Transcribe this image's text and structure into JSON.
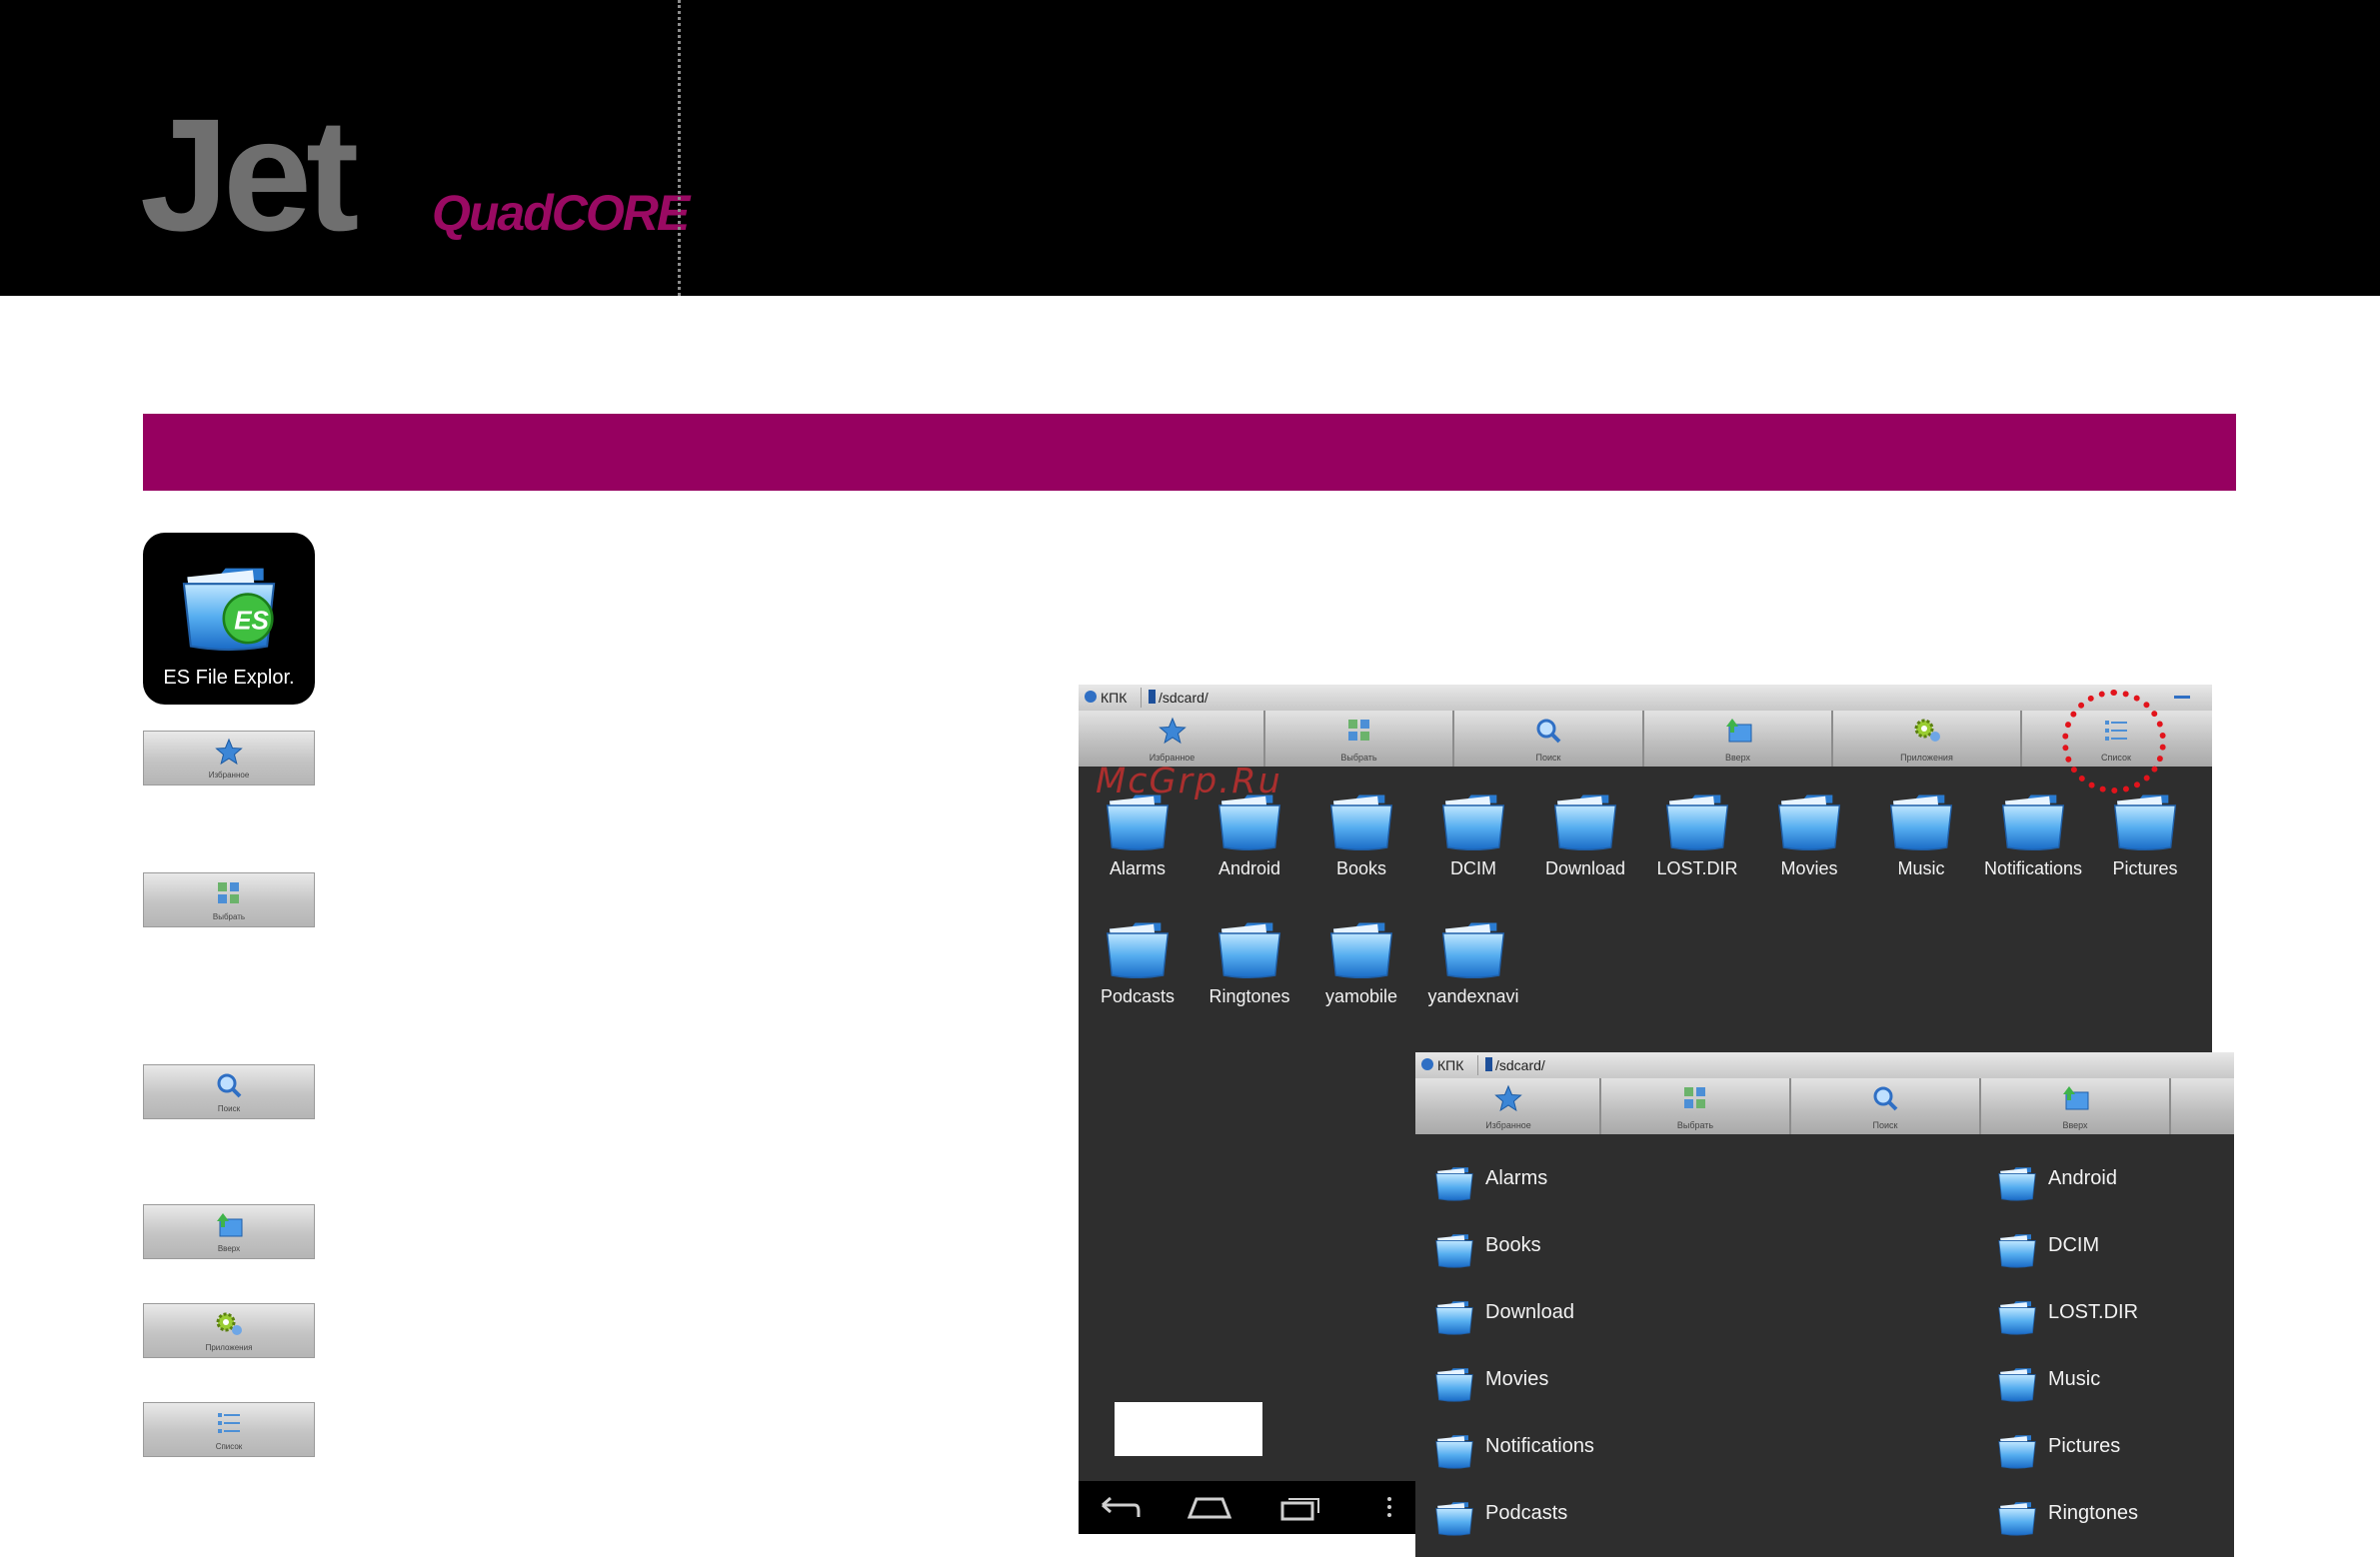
{
  "brand": {
    "name": "Jet",
    "subtitle": "QuadCORE"
  },
  "app_icon": {
    "label": "ES File Explor.",
    "icon": "es-file-explorer-icon"
  },
  "toolbar_buttons": [
    {
      "id": "favorites",
      "label": "Избранное",
      "icon": "star-icon"
    },
    {
      "id": "select",
      "label": "Выбрать",
      "icon": "select-grid-icon"
    },
    {
      "id": "search",
      "label": "Поиск",
      "icon": "magnifier-icon"
    },
    {
      "id": "up",
      "label": "Вверх",
      "icon": "folder-up-icon"
    },
    {
      "id": "apps",
      "label": "Приложения",
      "icon": "gear-apps-icon"
    },
    {
      "id": "list",
      "label": "Список",
      "icon": "list-view-icon"
    }
  ],
  "screen_grid": {
    "network_label": "КПК",
    "path": "/sdcard/",
    "folders": [
      "Alarms",
      "Android",
      "Books",
      "DCIM",
      "Download",
      "LOST.DIR",
      "Movies",
      "Music",
      "Notifications",
      "Pictures",
      "Podcasts",
      "Ringtones",
      "yamobile",
      "yandexnavi"
    ]
  },
  "screen_list": {
    "network_label": "КПК",
    "path": "/sdcard/",
    "left_column": [
      "Alarms",
      "Books",
      "Download",
      "Movies",
      "Notifications",
      "Podcasts"
    ],
    "right_column": [
      "Android",
      "DCIM",
      "LOST.DIR",
      "Music",
      "Pictures",
      "Ringtones"
    ]
  },
  "watermark": "McGrp.Ru",
  "colors": {
    "accent": "#960060",
    "brand_subtitle": "#9a0a63",
    "folder_blue": "#3a8fe0",
    "highlight": "#e2141c"
  }
}
